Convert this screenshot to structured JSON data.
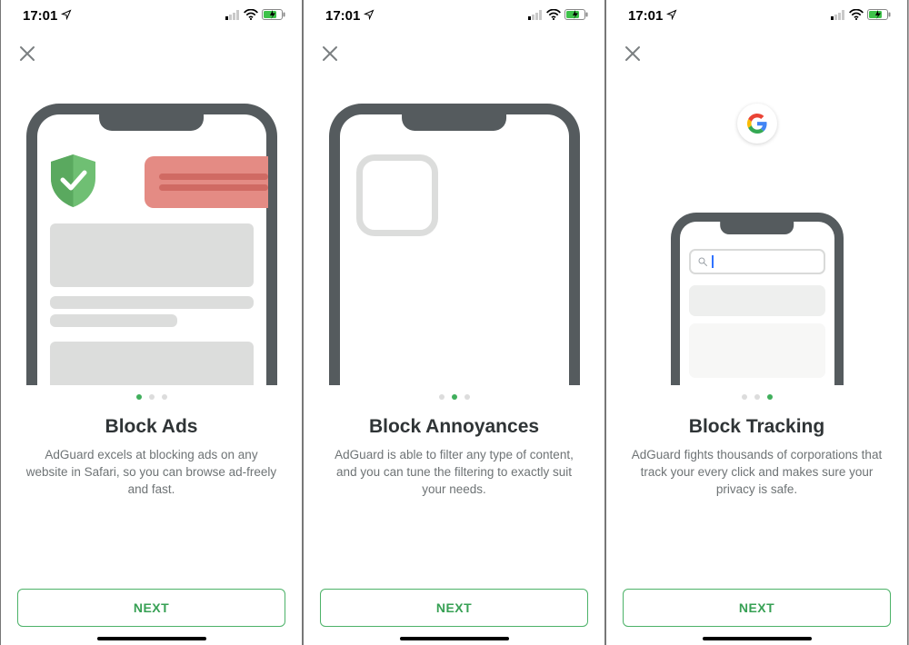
{
  "status": {
    "time": "17:01"
  },
  "screens": [
    {
      "title": "Block Ads",
      "desc": "AdGuard excels at blocking ads on any website in Safari, so you can browse ad-freely and fast.",
      "next": "NEXT",
      "active_dot": 0
    },
    {
      "title": "Block Annoyances",
      "desc": "AdGuard is able to filter any type of content, and you can tune the filtering to exactly suit your needs.",
      "next": "NEXT",
      "active_dot": 1
    },
    {
      "title": "Block Tracking",
      "desc": "AdGuard fights thousands of corporations that track your every click and makes sure your privacy is safe.",
      "next": "NEXT",
      "active_dot": 2
    }
  ]
}
